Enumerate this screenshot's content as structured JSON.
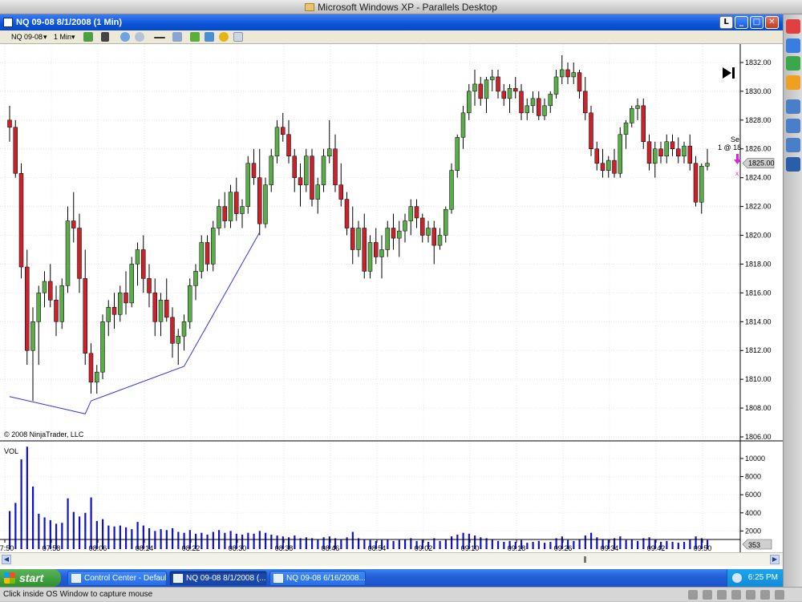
{
  "mac": {
    "window_title": "Microsoft Windows XP - Parallels Desktop",
    "status_text": "Click inside OS Window to capture mouse"
  },
  "window": {
    "title": "NQ 09-08  8/1/2008 (1 Min)"
  },
  "toolbar": {
    "instrument": "NQ 09-08",
    "interval": "1 Min"
  },
  "taskbar": {
    "start_label": "start",
    "items": [
      {
        "label": "Control Center - Default"
      },
      {
        "label": "NQ 09-08  8/1/2008 (..."
      },
      {
        "label": "NQ 09-08  6/16/2008..."
      }
    ],
    "clock": "6:25 PM"
  },
  "chart": {
    "copyright": "© 2008 NinjaTrader, LLC",
    "volume_label": "VOL",
    "last_price_label": "1825.00",
    "last_volume_label": "353",
    "order_label_1": "Sel",
    "order_label_2": "1 @ 18",
    "colors": {
      "up": "#5aab4a",
      "down": "#c8232c",
      "trendline": "#3535e0",
      "volume": "#1010c8"
    }
  },
  "chart_data": {
    "type": "candlestick",
    "price_axis": {
      "min": 1806,
      "max": 1833,
      "ticks": [
        "1806.00",
        "1808.00",
        "1810.00",
        "1812.00",
        "1814.00",
        "1816.00",
        "1818.00",
        "1820.00",
        "1822.00",
        "1824.00",
        "1826.00",
        "1828.00",
        "1830.00",
        "1832.00"
      ]
    },
    "volume_axis": {
      "min": 0,
      "max": 11500,
      "ticks": [
        "2000",
        "4000",
        "6000",
        "8000",
        "10000"
      ]
    },
    "time_axis": {
      "ticks": [
        "07:50",
        "07:58",
        "08:06",
        "08:14",
        "08:22",
        "08:30",
        "08:38",
        "08:46",
        "08:54",
        "09:02",
        "09:10",
        "09:18",
        "09:26",
        "09:34",
        "09:42",
        "09:50",
        "09:58",
        "10:06",
        "10:14",
        "10:22",
        "10:30"
      ]
    },
    "trendline": [
      [
        0,
        1808.8
      ],
      [
        13,
        1807.6
      ],
      [
        14,
        1808.5
      ],
      [
        30,
        1810.9
      ],
      [
        43,
        1820.2
      ]
    ],
    "last_price": 1825.0,
    "candles": [
      [
        1828,
        1829,
        1826.5,
        1827.5,
        4200
      ],
      [
        1827.5,
        1828,
        1824,
        1824.3,
        5100
      ],
      [
        1824.3,
        1825,
        1817,
        1817.8,
        9900
      ],
      [
        1817.8,
        1819,
        1811,
        1812,
        11300
      ],
      [
        1812,
        1815,
        1808.5,
        1814,
        6900
      ],
      [
        1814,
        1816.5,
        1811,
        1816,
        3900
      ],
      [
        1816,
        1817.5,
        1815,
        1816.8,
        3500
      ],
      [
        1816.8,
        1818,
        1815,
        1815.5,
        3200
      ],
      [
        1815.5,
        1816.5,
        1813,
        1814,
        2800
      ],
      [
        1814,
        1817,
        1813.5,
        1816.5,
        2900
      ],
      [
        1816.5,
        1822,
        1816,
        1821,
        5600
      ],
      [
        1821,
        1823,
        1819.5,
        1820.5,
        4100
      ],
      [
        1820.5,
        1821.5,
        1816,
        1817,
        3600
      ],
      [
        1817,
        1819,
        1811,
        1811.8,
        4000
      ],
      [
        1811.8,
        1812.5,
        1809,
        1809.8,
        5700
      ],
      [
        1809.8,
        1811,
        1809,
        1810.5,
        3100
      ],
      [
        1810.5,
        1814.5,
        1810,
        1814,
        3300
      ],
      [
        1814,
        1815.5,
        1813,
        1815,
        2600
      ],
      [
        1815,
        1816,
        1813.5,
        1814.5,
        2500
      ],
      [
        1814.5,
        1816.5,
        1814,
        1816,
        2600
      ],
      [
        1816,
        1817.5,
        1814.5,
        1815.3,
        2400
      ],
      [
        1815.3,
        1818.5,
        1815,
        1818,
        2200
      ],
      [
        1818,
        1819.5,
        1816.5,
        1819,
        3000
      ],
      [
        1819,
        1820,
        1816,
        1817,
        2600
      ],
      [
        1817,
        1818,
        1815,
        1816,
        2300
      ],
      [
        1816,
        1817,
        1813,
        1814,
        2000
      ],
      [
        1814,
        1816,
        1813,
        1815.5,
        2200
      ],
      [
        1815.5,
        1817,
        1814,
        1814.3,
        2100
      ],
      [
        1814.3,
        1815,
        1811.5,
        1812.5,
        2300
      ],
      [
        1812.5,
        1813.5,
        1811,
        1813,
        1900
      ],
      [
        1813,
        1814.5,
        1812,
        1814,
        1800
      ],
      [
        1814,
        1817,
        1813.5,
        1816.5,
        2100
      ],
      [
        1816.5,
        1818,
        1815.5,
        1817.5,
        1700
      ],
      [
        1817.5,
        1820,
        1817,
        1819.5,
        1800
      ],
      [
        1819.5,
        1820,
        1817.5,
        1818,
        1600
      ],
      [
        1818,
        1821,
        1817.5,
        1820.5,
        1900
      ],
      [
        1820.5,
        1822.5,
        1820,
        1822,
        2100
      ],
      [
        1822,
        1823,
        1820.5,
        1821,
        1800
      ],
      [
        1821,
        1823.5,
        1820.5,
        1823,
        2000
      ],
      [
        1823,
        1824,
        1821,
        1821.5,
        1700
      ],
      [
        1821.5,
        1822.5,
        1820.5,
        1822,
        1600
      ],
      [
        1822,
        1825.5,
        1821.5,
        1825,
        1800
      ],
      [
        1825,
        1826,
        1823.5,
        1824,
        1700
      ],
      [
        1824,
        1826,
        1820,
        1820.8,
        2000
      ],
      [
        1820.8,
        1824,
        1820.5,
        1823.5,
        1800
      ],
      [
        1823.5,
        1826,
        1823,
        1825.5,
        1600
      ],
      [
        1825.5,
        1828,
        1825,
        1827.5,
        1500
      ],
      [
        1827.5,
        1828.5,
        1826.5,
        1827,
        1400
      ],
      [
        1827,
        1828,
        1825,
        1825.5,
        1300
      ],
      [
        1825.5,
        1826,
        1823,
        1824,
        1500
      ],
      [
        1824,
        1825,
        1822,
        1823.5,
        1200
      ],
      [
        1823.5,
        1826,
        1823,
        1825.5,
        1300
      ],
      [
        1825.5,
        1826,
        1822,
        1822.5,
        1200
      ],
      [
        1822.5,
        1824,
        1821.5,
        1823.5,
        1100
      ],
      [
        1823.5,
        1826,
        1823,
        1825.5,
        1300
      ],
      [
        1825.5,
        1828,
        1825,
        1826,
        1400
      ],
      [
        1826,
        1827,
        1823,
        1823.5,
        1200
      ],
      [
        1823.5,
        1825,
        1822,
        1822.5,
        1100
      ],
      [
        1822.5,
        1823,
        1820,
        1820.5,
        1300
      ],
      [
        1820.5,
        1822,
        1818,
        1819,
        1900
      ],
      [
        1819,
        1821,
        1818.5,
        1820.5,
        1200
      ],
      [
        1820.5,
        1821.5,
        1817,
        1817.5,
        1100
      ],
      [
        1817.5,
        1820,
        1817,
        1819.5,
        1000
      ],
      [
        1819.5,
        1820.5,
        1818,
        1818.5,
        900
      ],
      [
        1818.5,
        1820,
        1817,
        1819,
        1000
      ],
      [
        1819,
        1821,
        1818.5,
        1820.5,
        1100
      ],
      [
        1820.5,
        1821.5,
        1819,
        1819.8,
        900
      ],
      [
        1819.8,
        1821,
        1818.5,
        1820.3,
        1000
      ],
      [
        1820.3,
        1821.5,
        1819.5,
        1821,
        1100
      ],
      [
        1821,
        1822.5,
        1820,
        1822,
        1200
      ],
      [
        1822,
        1822.5,
        1820.5,
        1821.2,
        900
      ],
      [
        1821.2,
        1821.5,
        1819.5,
        1820,
        1000
      ],
      [
        1820,
        1821,
        1819.5,
        1820.5,
        800
      ],
      [
        1820.5,
        1821,
        1818,
        1819.3,
        1200
      ],
      [
        1819.3,
        1820.5,
        1819,
        1820,
        900
      ],
      [
        1820,
        1822,
        1819.5,
        1821.8,
        1100
      ],
      [
        1821.8,
        1825,
        1821.5,
        1824.5,
        1400
      ],
      [
        1824.5,
        1827,
        1824,
        1826.8,
        1600
      ],
      [
        1826.8,
        1829,
        1826,
        1828.5,
        1800
      ],
      [
        1828.5,
        1830.5,
        1828,
        1830,
        1700
      ],
      [
        1830,
        1831.5,
        1829,
        1830.5,
        1500
      ],
      [
        1830.5,
        1831,
        1829,
        1829.5,
        1300
      ],
      [
        1829.5,
        1831,
        1828.5,
        1830.8,
        1200
      ],
      [
        1830.8,
        1831.5,
        1830,
        1831,
        1100
      ],
      [
        1831,
        1831.5,
        1829.5,
        1830,
        900
      ],
      [
        1830,
        1830.5,
        1829,
        1829.5,
        800
      ],
      [
        1829.5,
        1830.5,
        1828.5,
        1830.2,
        900
      ],
      [
        1830.2,
        1831,
        1829.5,
        1830,
        800
      ],
      [
        1830,
        1830.5,
        1828,
        1828.5,
        1000
      ],
      [
        1828.5,
        1829.5,
        1828,
        1829,
        700
      ],
      [
        1829,
        1830,
        1828.5,
        1829.5,
        800
      ],
      [
        1829.5,
        1830,
        1828,
        1828.3,
        900
      ],
      [
        1828.3,
        1829.5,
        1828,
        1829,
        700
      ],
      [
        1829,
        1830,
        1828.5,
        1829.8,
        800
      ],
      [
        1829.8,
        1831.5,
        1829.5,
        1831,
        1200
      ],
      [
        1831,
        1832.5,
        1830.5,
        1831.5,
        1400
      ],
      [
        1831.5,
        1832,
        1830.5,
        1831,
        1000
      ],
      [
        1831,
        1832,
        1830.5,
        1831.3,
        900
      ],
      [
        1831.3,
        1831.5,
        1829.5,
        1830,
        1100
      ],
      [
        1830,
        1831,
        1828,
        1828.5,
        1500
      ],
      [
        1828.5,
        1829,
        1825.5,
        1826,
        1800
      ],
      [
        1826,
        1826.5,
        1824.5,
        1825,
        1300
      ],
      [
        1825,
        1826,
        1824,
        1824.5,
        1100
      ],
      [
        1824.5,
        1825.5,
        1824,
        1825.2,
        1000
      ],
      [
        1825.2,
        1826,
        1824,
        1824.3,
        1200
      ],
      [
        1824.3,
        1827.5,
        1824,
        1827,
        1400
      ],
      [
        1827,
        1828,
        1826,
        1827.8,
        1000
      ],
      [
        1827.8,
        1829,
        1827.5,
        1828.8,
        1100
      ],
      [
        1828.8,
        1829.5,
        1828,
        1829,
        900
      ],
      [
        1829,
        1829.5,
        1826,
        1826.5,
        1200
      ],
      [
        1826.5,
        1827,
        1824.5,
        1825,
        1300
      ],
      [
        1825,
        1826.5,
        1824,
        1826,
        1000
      ],
      [
        1826,
        1826.5,
        1825,
        1825.5,
        800
      ],
      [
        1825.5,
        1827,
        1825,
        1826.5,
        900
      ],
      [
        1826.5,
        1827,
        1825.5,
        1826,
        800
      ],
      [
        1826,
        1826.8,
        1825,
        1825.5,
        700
      ],
      [
        1825.5,
        1826.5,
        1825,
        1826.2,
        800
      ],
      [
        1826.2,
        1827,
        1824.5,
        1825,
        1100
      ],
      [
        1825,
        1825.5,
        1822,
        1822.3,
        1400
      ],
      [
        1822.3,
        1825,
        1821.5,
        1824.8,
        1200
      ],
      [
        1824.8,
        1826,
        1824.5,
        1825,
        1000
      ]
    ]
  }
}
